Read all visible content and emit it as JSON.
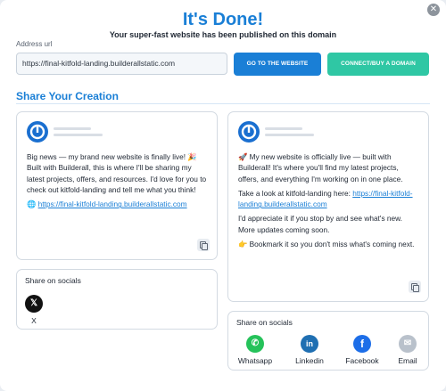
{
  "header": {
    "title": "It's Done!",
    "subtitle": "Your super-fast website has been published on this domain",
    "close_icon": "close-icon"
  },
  "address": {
    "label": "Address url",
    "value": "https://final-kitfold-landing.builderallstatic.com"
  },
  "buttons": {
    "go_to_website": "GO TO THE WEBSITE",
    "connect_domain": "CONNECT/BUY A DOMAIN"
  },
  "share": {
    "title": "Share Your Creation"
  },
  "post_left": {
    "para1": "Big news — my brand new website is finally live! 🎉 Built with Builderall, this is where I'll be sharing my latest projects, offers, and resources. I'd love for you to check out kitfold-landing and tell me what you think!",
    "link_prefix": "🌐 ",
    "link": "https://final-kitfold-landing.builderallstatic.com"
  },
  "post_right": {
    "para1": "🚀 My new website is officially live — built with Builderall! It's where you'll find my latest projects, offers, and everything I'm working on in one place.",
    "link_prefix": "Take a look at kitfold-landing here: ",
    "link": "https://final-kitfold-landing.builderallstatic.com",
    "para3": "I'd appreciate it if you stop by and see what's new. More updates coming soon.",
    "para4": "👉 Bookmark it so you don't miss what's coming next."
  },
  "socials_left": {
    "title": "Share on socials",
    "items": [
      {
        "label": "X",
        "icon": "x-icon",
        "color": "#111111"
      }
    ]
  },
  "socials_right": {
    "title": "Share on socials",
    "items": [
      {
        "label": "Whatsapp",
        "icon": "whatsapp-icon",
        "color": "#25c25a"
      },
      {
        "label": "Linkedin",
        "icon": "linkedin-icon",
        "color": "#1f6fb2"
      },
      {
        "label": "Facebook",
        "icon": "facebook-icon",
        "color": "#1d6ee8"
      },
      {
        "label": "Email",
        "icon": "email-icon",
        "color": "#b9c1cb"
      }
    ]
  },
  "colors": {
    "primary": "#1a7fd6",
    "accent": "#2fc7a4"
  }
}
